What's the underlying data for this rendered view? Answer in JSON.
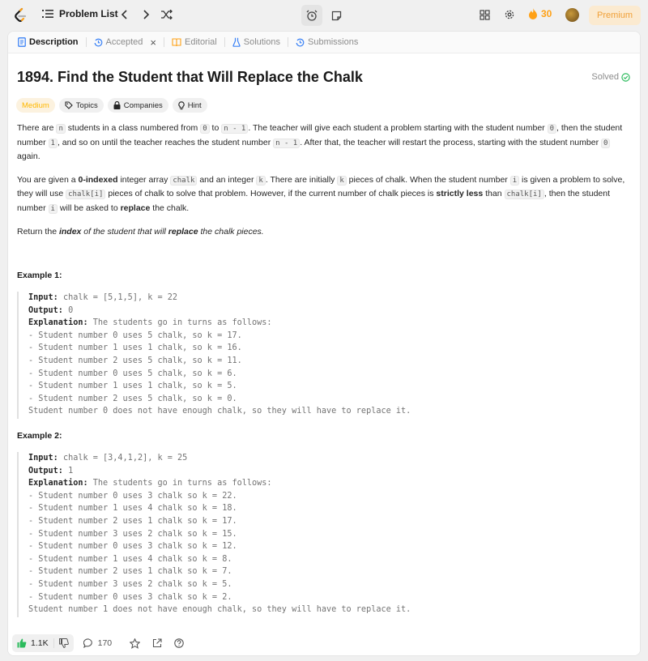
{
  "topbar": {
    "problem_list_label": "Problem List",
    "streak_count": "30",
    "premium_label": "Premium"
  },
  "tabs": [
    {
      "label": "Description",
      "icon": "description-icon",
      "active": true
    },
    {
      "label": "Accepted",
      "icon": "history-icon",
      "active": false,
      "closable": true
    },
    {
      "label": "Editorial",
      "icon": "book-icon",
      "active": false
    },
    {
      "label": "Solutions",
      "icon": "flask-icon",
      "active": false
    },
    {
      "label": "Submissions",
      "icon": "history-icon",
      "active": false
    }
  ],
  "problem": {
    "title": "1894. Find the Student that Will Replace the Chalk",
    "status": "Solved",
    "difficulty": "Medium",
    "chips": [
      "Topics",
      "Companies",
      "Hint"
    ]
  },
  "description": {
    "p1": {
      "t1": "There are ",
      "c1": "n",
      "t2": " students in a class numbered from ",
      "c2": "0",
      "t3": " to ",
      "c3": "n - 1",
      "t4": ". The teacher will give each student a problem starting with the student number ",
      "c4": "0",
      "t5": ", then the student number ",
      "c5": "1",
      "t6": ", and so on until the teacher reaches the student number ",
      "c6": "n - 1",
      "t7": ". After that, the teacher will restart the process, starting with the student number ",
      "c7": "0",
      "t8": " again."
    },
    "p2": {
      "t1": "You are given a ",
      "b1": "0-indexed",
      "t2": " integer array ",
      "c1": "chalk",
      "t3": " and an integer ",
      "c2": "k",
      "t4": ". There are initially ",
      "c3": "k",
      "t5": " pieces of chalk. When the student number ",
      "c4": "i",
      "t6": " is given a problem to solve, they will use ",
      "c5": "chalk[i]",
      "t7": " pieces of chalk to solve that problem. However, if the current number of chalk pieces is ",
      "b2": "strictly less",
      "t8": " than ",
      "c6": "chalk[i]",
      "t9": ", then the student number ",
      "c7": "i",
      "t10": " will be asked to ",
      "b3": "replace",
      "t11": " the chalk."
    },
    "p3": {
      "t1": "Return the ",
      "b1": "index",
      "t2": " of the student that will ",
      "b2": "replace",
      "t3": " the chalk pieces."
    }
  },
  "examples": [
    {
      "heading": "Example 1:",
      "input_label": "Input:",
      "input": " chalk = [5,1,5], k = 22",
      "output_label": "Output:",
      "output": " 0",
      "explanation_label": "Explanation:",
      "explanation": " The students go in turns as follows:",
      "lines": [
        "- Student number 0 uses 5 chalk, so k = 17.",
        "- Student number 1 uses 1 chalk, so k = 16.",
        "- Student number 2 uses 5 chalk, so k = 11.",
        "- Student number 0 uses 5 chalk, so k = 6.",
        "- Student number 1 uses 1 chalk, so k = 5.",
        "- Student number 2 uses 5 chalk, so k = 0.",
        "Student number 0 does not have enough chalk, so they will have to replace it."
      ]
    },
    {
      "heading": "Example 2:",
      "input_label": "Input:",
      "input": " chalk = [3,4,1,2], k = 25",
      "output_label": "Output:",
      "output": " 1",
      "explanation_label": "Explanation:",
      "explanation": " The students go in turns as follows:",
      "lines": [
        "- Student number 0 uses 3 chalk so k = 22.",
        "- Student number 1 uses 4 chalk so k = 18.",
        "- Student number 2 uses 1 chalk so k = 17.",
        "- Student number 3 uses 2 chalk so k = 15.",
        "- Student number 0 uses 3 chalk so k = 12.",
        "- Student number 1 uses 4 chalk so k = 8.",
        "- Student number 2 uses 1 chalk so k = 7.",
        "- Student number 3 uses 2 chalk so k = 5.",
        "- Student number 0 uses 3 chalk so k = 2.",
        "Student number 1 does not have enough chalk, so they will have to replace it."
      ]
    }
  ],
  "bottom": {
    "likes": "1.1K",
    "comments": "170"
  },
  "colors": {
    "accent": "#ffa116",
    "easy_green": "#2cbb5d",
    "medium": "#ffb800",
    "premium_bg": "#fbead0"
  }
}
